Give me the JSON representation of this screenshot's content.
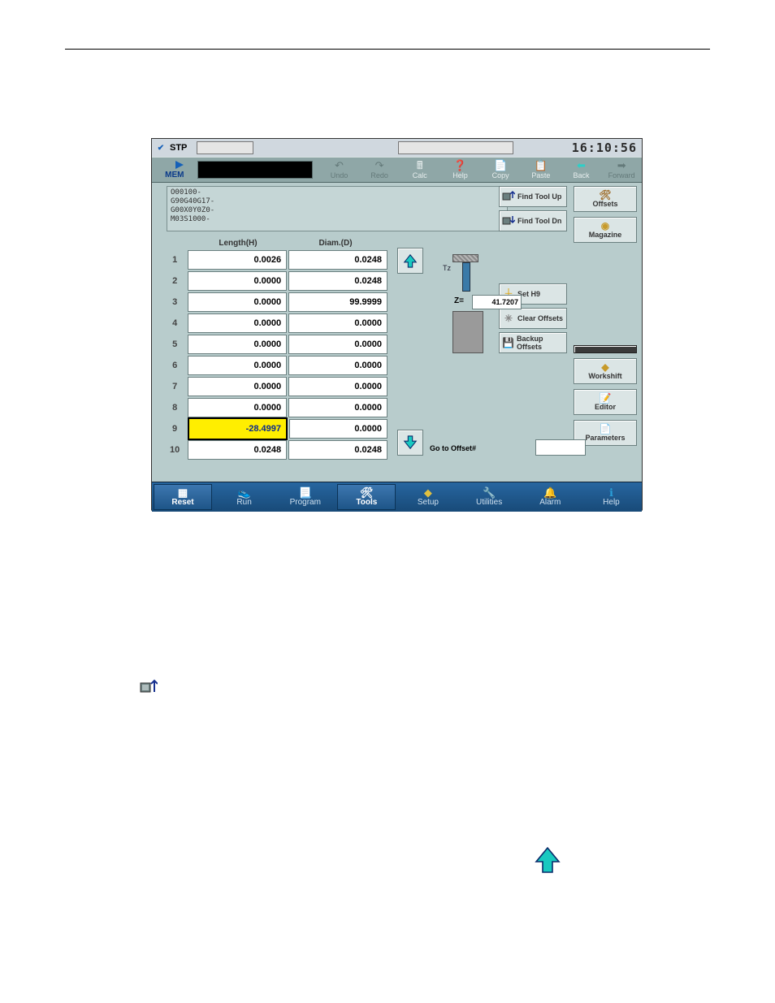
{
  "topbar": {
    "status": "STP",
    "clock": "16:10:56"
  },
  "menubar": {
    "mem": "MEM",
    "items": [
      {
        "label": "Undo"
      },
      {
        "label": "Redo"
      },
      {
        "label": "Calc"
      },
      {
        "label": "Help"
      },
      {
        "label": "Copy"
      },
      {
        "label": "Paste"
      },
      {
        "label": "Back"
      },
      {
        "label": "Forward"
      }
    ]
  },
  "program_lines": [
    "O00100-",
    "G90G40G17-",
    "G00X0Y0Z0-",
    "M03S1000-"
  ],
  "table": {
    "headers": {
      "length": "Length(H)",
      "diam": "Diam.(D)"
    },
    "rows": [
      {
        "n": "1",
        "len": "0.0026",
        "dia": "0.0248"
      },
      {
        "n": "2",
        "len": "0.0000",
        "dia": "0.0248"
      },
      {
        "n": "3",
        "len": "0.0000",
        "dia": "99.9999"
      },
      {
        "n": "4",
        "len": "0.0000",
        "dia": "0.0000"
      },
      {
        "n": "5",
        "len": "0.0000",
        "dia": "0.0000"
      },
      {
        "n": "6",
        "len": "0.0000",
        "dia": "0.0000"
      },
      {
        "n": "7",
        "len": "0.0000",
        "dia": "0.0000"
      },
      {
        "n": "8",
        "len": "0.0000",
        "dia": "0.0000"
      },
      {
        "n": "9",
        "len": "-28.4997",
        "dia": "0.0000"
      },
      {
        "n": "10",
        "len": "0.0248",
        "dia": "0.0248"
      }
    ],
    "selected_row": 8
  },
  "midpanel": {
    "tz": "Tz",
    "z_label": "Z=",
    "z_value": "41.7207",
    "goto_label": "Go to Offset#"
  },
  "side_buttons": {
    "find_up": "Find Tool Up",
    "find_dn": "Find Tool Dn",
    "set": "Set H9",
    "clear": "Clear Offsets",
    "backup": "Backup Offsets"
  },
  "right_buttons": {
    "offsets": "Offsets",
    "magazine": "Magazine",
    "workshift": "Workshift",
    "editor": "Editor",
    "parameters": "Parameters"
  },
  "bottombar": {
    "items": [
      "Reset",
      "Run",
      "Program",
      "Tools",
      "Setup",
      "Utilities",
      "Alarm",
      "Help"
    ]
  }
}
